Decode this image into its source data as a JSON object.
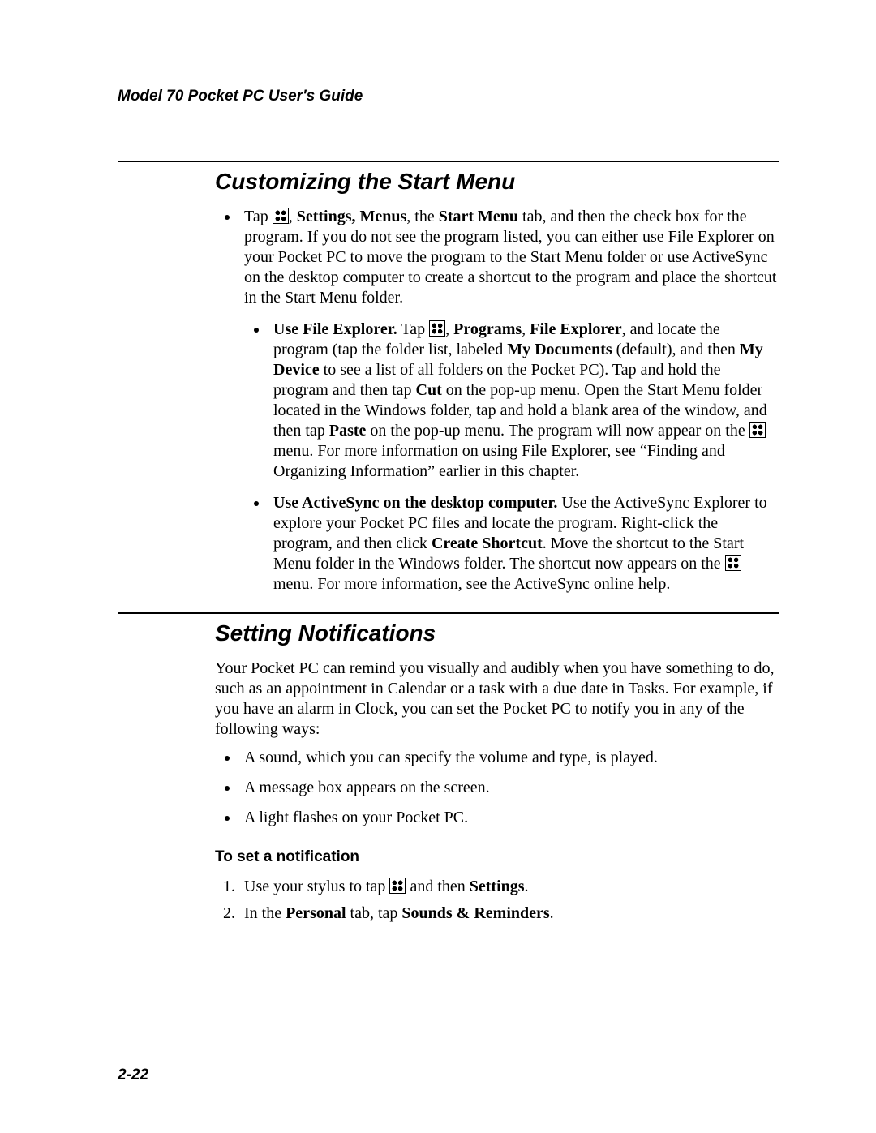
{
  "header": "Model 70 Pocket PC User's Guide",
  "section1": {
    "title": "Customizing the Start Menu",
    "main_a": "Tap ",
    "main_b": ", ",
    "main_c": "Settings, Menus",
    "main_d": ", the ",
    "main_e": "Start Menu",
    "main_f": " tab, and then the check box for the program. If you do not see the program listed, you can either use File Explorer on your Pocket PC to move the program to the Start Menu folder or use ActiveSync on the desktop computer to create a shortcut to the program and place the shortcut in the Start Menu folder.",
    "fe_a": "Use File Explorer.",
    "fe_b": " Tap ",
    "fe_c": ", ",
    "fe_d": "Programs",
    "fe_e": ", ",
    "fe_f": "File Explorer",
    "fe_g": ", and locate the program (tap the folder list, labeled ",
    "fe_h": "My Documents",
    "fe_i": " (default), and then ",
    "fe_j": "My Device",
    "fe_k": " to see a list of all folders on the Pocket PC). Tap and hold the program and then tap ",
    "fe_l": "Cut",
    "fe_m": " on the pop-up menu. Open the Start Menu folder located in the Windows folder, tap and hold a blank area of the window, and then tap ",
    "fe_n": "Paste",
    "fe_o": " on the pop-up menu. The program will now appear on the ",
    "fe_p": " menu. For more information on using File Explorer, see “Finding and Organizing Information” earlier in this chapter.",
    "as_a": "Use ActiveSync on the desktop computer.",
    "as_b": " Use the ActiveSync Explorer to explore your Pocket PC files and locate the program. Right-click the program, and then click ",
    "as_c": "Create Shortcut",
    "as_d": ". Move the shortcut to the Start Menu folder in the Windows folder. The shortcut now appears on the ",
    "as_e": " menu. For more information, see the ActiveSync online help."
  },
  "section2": {
    "title": "Setting Notifications",
    "intro": "Your Pocket PC can remind you visually and audibly when you have something to do, such as an appointment in Calendar or a task with a due date in Tasks. For example, if you have an alarm in Clock, you can set the Pocket PC to notify you in any of the following ways:",
    "bullets": [
      "A sound, which you can specify the volume and type, is played.",
      "A message box appears on the screen.",
      "A light flashes on your Pocket PC."
    ],
    "subhead": "To set a notification",
    "step1_a": "Use your stylus to tap ",
    "step1_b": " and then ",
    "step1_c": "Settings",
    "step1_d": ".",
    "step2_a": "In the ",
    "step2_b": "Personal",
    "step2_c": " tab, tap ",
    "step2_d": "Sounds & Reminders",
    "step2_e": "."
  },
  "footer": "2-22"
}
